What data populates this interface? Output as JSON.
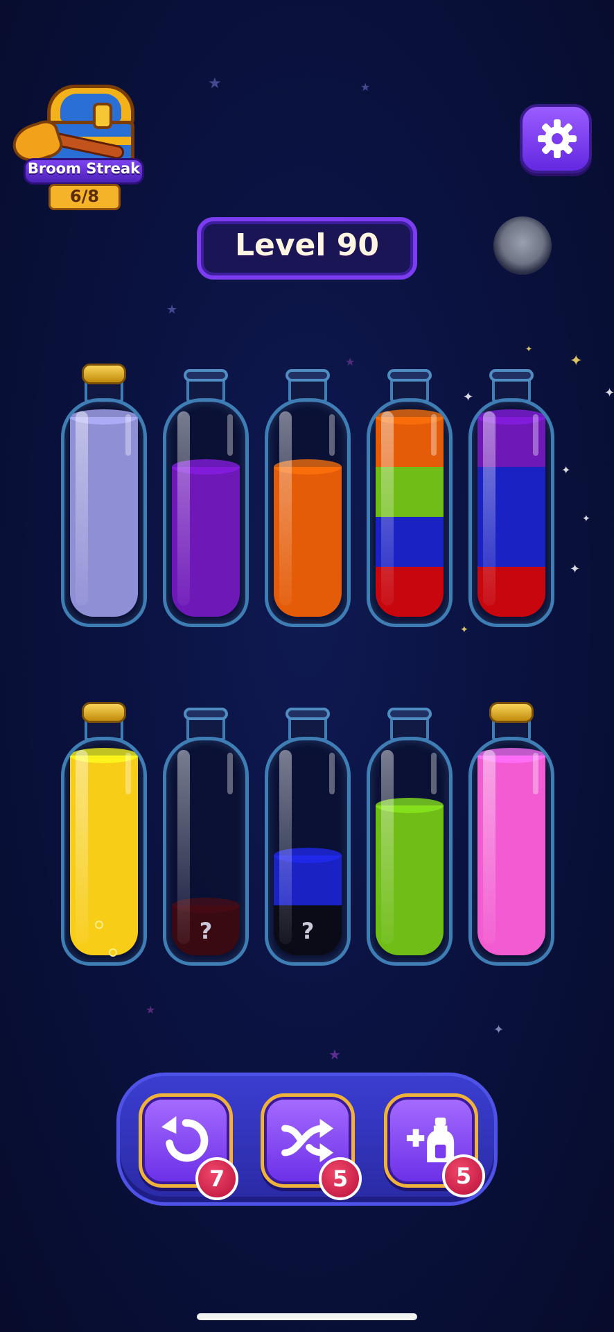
{
  "hud": {
    "streak_label": "Broom Streak",
    "streak_count": "6/8",
    "level_label": "Level 90"
  },
  "icons": {
    "settings": "gear-icon",
    "undo": "undo-icon",
    "shuffle": "shuffle-icon",
    "add_bottle": "add-bottle-icon"
  },
  "colors": {
    "lavender": "#8f8fd6",
    "purple": "#6e18b8",
    "orange": "#e45c08",
    "green": "#6fbd16",
    "blue": "#1b22c4",
    "red": "#c8060e",
    "yellow": "#f7cd18",
    "pink": "#f25bd1",
    "dark_red": "#3a0a12",
    "black": "#0b0b18"
  },
  "bottles_row1": [
    {
      "corked": true,
      "layers": [
        {
          "color": "#8f8fd6",
          "units": 4
        }
      ]
    },
    {
      "corked": false,
      "layers": [
        {
          "color": "#6e18b8",
          "units": 3
        }
      ]
    },
    {
      "corked": false,
      "layers": [
        {
          "color": "#e45c08",
          "units": 3
        }
      ]
    },
    {
      "corked": false,
      "layers": [
        {
          "color": "#c8060e",
          "units": 1
        },
        {
          "color": "#1b22c4",
          "units": 1
        },
        {
          "color": "#6fbd16",
          "units": 1
        },
        {
          "color": "#e45c08",
          "units": 1
        }
      ]
    },
    {
      "corked": false,
      "layers": [
        {
          "color": "#c8060e",
          "units": 1
        },
        {
          "color": "#1b22c4",
          "units": 2
        },
        {
          "color": "#6e18b8",
          "units": 1
        }
      ]
    }
  ],
  "bottles_row2": [
    {
      "corked": true,
      "layers": [
        {
          "color": "#f7cd18",
          "units": 4
        }
      ]
    },
    {
      "corked": false,
      "layers": [
        {
          "color": "#3a0a12",
          "units": 1,
          "hidden": true
        }
      ]
    },
    {
      "corked": false,
      "layers": [
        {
          "color": "#0b0b18",
          "units": 1,
          "hidden": true
        },
        {
          "color": "#1b22c4",
          "units": 1
        }
      ]
    },
    {
      "corked": false,
      "layers": [
        {
          "color": "#6fbd16",
          "units": 3
        }
      ]
    },
    {
      "corked": true,
      "layers": [
        {
          "color": "#f25bd1",
          "units": 4
        }
      ]
    }
  ],
  "mystery_mark": "?",
  "powerups": [
    {
      "name": "undo",
      "count": "7"
    },
    {
      "name": "shuffle",
      "count": "5"
    },
    {
      "name": "add-bottle",
      "count": "5"
    }
  ]
}
